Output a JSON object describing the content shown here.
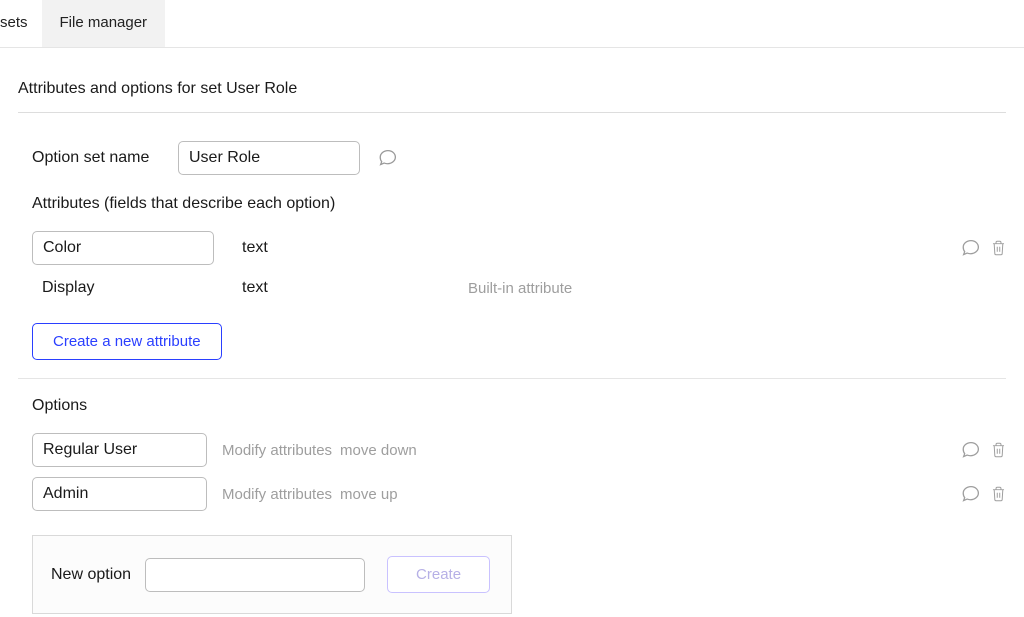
{
  "tabs": {
    "partial": "sets",
    "file_manager": "File manager"
  },
  "page_title": "Attributes and options for set User Role",
  "option_set": {
    "name_label": "Option set name",
    "name_value": "User Role"
  },
  "attributes": {
    "heading": "Attributes (fields that describe each option)",
    "rows": [
      {
        "name": "Color",
        "type": "text"
      }
    ],
    "builtin": {
      "name": "Display",
      "type": "text",
      "note": "Built-in attribute"
    },
    "create_button": "Create a new attribute"
  },
  "options": {
    "heading": "Options",
    "rows": [
      {
        "name": "Regular User",
        "modify": "Modify attributes",
        "move": "move down"
      },
      {
        "name": "Admin",
        "modify": "Modify attributes",
        "move": "move up"
      }
    ],
    "new_option_label": "New option",
    "new_option_value": "",
    "create_button": "Create"
  }
}
